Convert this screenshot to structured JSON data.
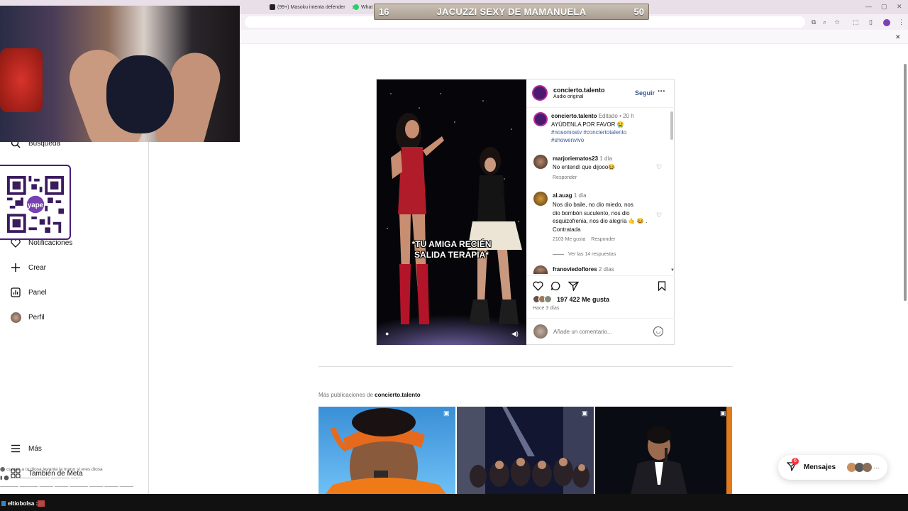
{
  "browser": {
    "tabs": [
      {
        "label": "(99+) Masoku intenta defender"
      },
      {
        "label": "What"
      }
    ]
  },
  "stream_bar": {
    "left_number": "16",
    "title": "JACUZZI SEXY DE MAMANUELA",
    "right_number": "50"
  },
  "sidebar": {
    "items": [
      {
        "label": "Búsqueda",
        "icon": "search-icon"
      },
      {
        "label": "Notificaciones",
        "icon": "heart-icon"
      },
      {
        "label": "Crear",
        "icon": "plus-icon"
      },
      {
        "label": "Panel",
        "icon": "chart-icon"
      },
      {
        "label": "Perfil",
        "icon": "avatar-icon"
      }
    ],
    "more_label": "Más",
    "meta_label": "También de Meta"
  },
  "post": {
    "username": "concierto.talento",
    "audio": "Audio original",
    "follow": "Seguir",
    "caption_user": "concierto.talento",
    "caption_edited": "Editado",
    "caption_time": "20 h",
    "caption_text": "AYÚDENLA POR FAVOR 😭",
    "hashtags": [
      "#nosomostv #conciertotalento",
      "#showenvivo"
    ],
    "video_caption": [
      "*TU AMIGA RECIÉN",
      "SALIDA TERAPIA*"
    ],
    "comments": [
      {
        "user": "marjoriematos23",
        "time": "1 día",
        "text": "No entendí que dijooo😂",
        "reply": "Responder"
      },
      {
        "user": "al.auag",
        "time": "1 día",
        "lines": [
          "Nos dio baile, no dio miedo, nos",
          "dio bombón suculento, nos dio",
          "esquizofrenia, nos dio alegría 🤙 😂 .",
          "Contratada"
        ],
        "likes": "2103 Me gusta",
        "reply": "Responder",
        "view_replies": "Ver las 14 respuestas"
      },
      {
        "user": "franoviedoflores",
        "time": "2 días"
      }
    ],
    "likes_count": "197 422 Me gusta",
    "posted": "Hace 3 días",
    "comment_placeholder": "Añade un comentario..."
  },
  "more_posts": {
    "prefix": "Más publicaciones de",
    "user": "concierto.talento"
  },
  "messages": {
    "label": "Mensajes",
    "badge": "6"
  },
  "chat": {
    "lines": [
      "⬤ cuanto a tu diosa levanta la mano si eres diosa",
      "▮ ⬤ : ———————— ———— ——",
      "———— ———— ——— ——— ———— ——— ——— ———"
    ],
    "user": "eltiobolsa :"
  },
  "colors": {
    "accent": "#0095f6",
    "brand": "#4b1a6e"
  }
}
